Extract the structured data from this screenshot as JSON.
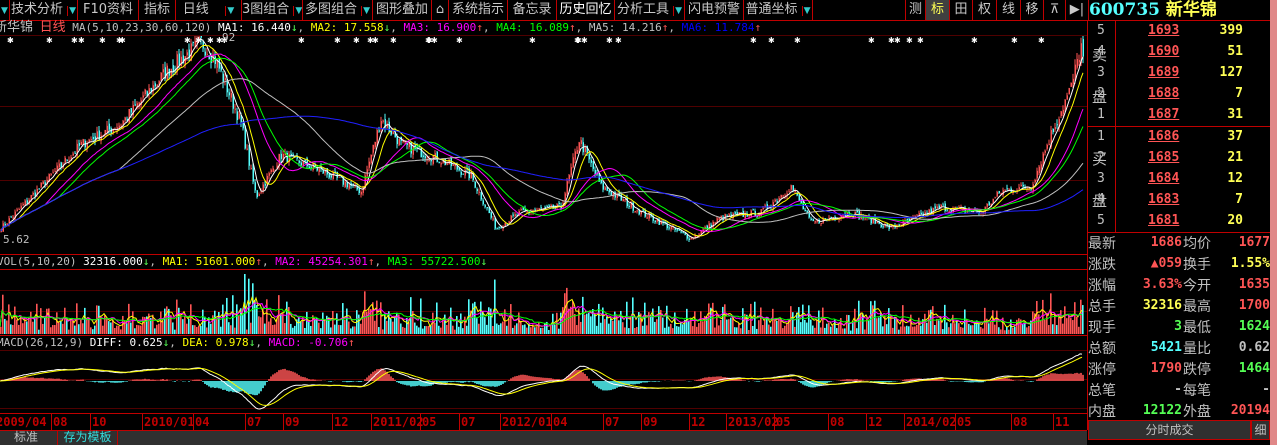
{
  "toolbar": {
    "items": [
      "技术分析",
      "F10资料",
      "指标",
      "日线",
      "3图组合",
      "多图组合",
      "图形叠加",
      "系统指示",
      "备忘录",
      "历史回忆",
      "分析工具",
      "闪电预警",
      "普通坐标"
    ],
    "right_buttons": [
      "测",
      "标",
      "田",
      "权",
      "线",
      "移"
    ],
    "icons": [
      "lock-icon",
      "dropdown-triangle-icon",
      "window-icon",
      "play-end-icon"
    ]
  },
  "stock": {
    "code": "600735",
    "name": "新华锦"
  },
  "main_header": {
    "name": "新华锦",
    "period": "日线",
    "ma_params": "MA(5,10,23,30,60,120)",
    "ma": [
      {
        "label": "MA1: 16.440",
        "arrow": "↓",
        "color": "#ffffff"
      },
      {
        "label": "MA2: 17.558",
        "arrow": "↓",
        "color": "#ffff00"
      },
      {
        "label": "MA3: 16.900",
        "arrow": "↑",
        "color": "#ff00ff"
      },
      {
        "label": "MA4: 16.089",
        "arrow": "↑",
        "color": "#00ff00"
      },
      {
        "label": "MA5: 14.216",
        "arrow": "↑",
        "color": "#c0c0c0"
      },
      {
        "label": "MA6: 11.784",
        "arrow": "↑",
        "color": "#0000ff"
      }
    ],
    "high_label": "92",
    "low_label": "5.62"
  },
  "vol_header": {
    "params": "VOL(5,10,20)",
    "value": "32316.000",
    "value_arrow": "↓",
    "ma1": "MA1: 51601.000",
    "ma1_arrow": "↑",
    "ma2": "MA2: 45254.301",
    "ma2_arrow": "↑",
    "ma3": "MA3: 55722.500",
    "ma3_arrow": "↓"
  },
  "macd_header": {
    "params": "MACD(26,12,9)",
    "diff": "DIFF: 0.625",
    "diff_arrow": "↓",
    "dea": "DEA: 0.978",
    "dea_arrow": "↓",
    "macd": "MACD: -0.706",
    "macd_arrow": "↑"
  },
  "date_axis": [
    "2009/04",
    "08",
    "10",
    "2010/01",
    "04",
    "07",
    "09",
    "12",
    "2011/02",
    "05",
    "07",
    "2012/01",
    "04",
    "07",
    "09",
    "12",
    "2013/02",
    "05",
    "08",
    "12",
    "2014/02",
    "05",
    "08",
    "11"
  ],
  "bottom_tabs": [
    "标准",
    "存为模板"
  ],
  "order_book": {
    "sell_label": [
      "卖",
      "盘"
    ],
    "buy_label": [
      "买",
      "盘"
    ],
    "sell": [
      {
        "level": "5",
        "price": "1693",
        "vol": "399"
      },
      {
        "level": "4",
        "price": "1690",
        "vol": "51"
      },
      {
        "level": "3",
        "price": "1689",
        "vol": "127"
      },
      {
        "level": "2",
        "price": "1688",
        "vol": "7"
      },
      {
        "level": "1",
        "price": "1687",
        "vol": "31"
      }
    ],
    "buy": [
      {
        "level": "1",
        "price": "1686",
        "vol": "37"
      },
      {
        "level": "2",
        "price": "1685",
        "vol": "21"
      },
      {
        "level": "3",
        "price": "1684",
        "vol": "12"
      },
      {
        "level": "4",
        "price": "1683",
        "vol": "7"
      },
      {
        "level": "5",
        "price": "1681",
        "vol": "20"
      }
    ]
  },
  "quote": [
    {
      "l1": "最新",
      "v1": "1686",
      "c1": "#ff5555",
      "l2": "均价",
      "v2": "1677",
      "c2": "#ff5555"
    },
    {
      "l1": "涨跌",
      "v1": "▲059",
      "c1": "#ff5555",
      "l2": "换手",
      "v2": "1.55%",
      "c2": "#ffff55"
    },
    {
      "l1": "涨幅",
      "v1": "3.63%",
      "c1": "#ff5555",
      "l2": "今开",
      "v2": "1635",
      "c2": "#ff5555"
    },
    {
      "l1": "总手",
      "v1": "32316",
      "c1": "#ffff55",
      "l2": "最高",
      "v2": "1700",
      "c2": "#ff5555"
    },
    {
      "l1": "现手",
      "v1": "3",
      "c1": "#55ff55",
      "l2": "最低",
      "v2": "1624",
      "c2": "#55ff55"
    },
    {
      "l1": "总额",
      "v1": "5421",
      "c1": "#55ffff",
      "l2": "量比",
      "v2": "0.62",
      "c2": "#c0c0c0"
    },
    {
      "l1": "涨停",
      "v1": "1790",
      "c1": "#ff5555",
      "l2": "跌停",
      "v2": "1464",
      "c2": "#55ff55"
    },
    {
      "l1": "总笔",
      "v1": "-",
      "c1": "#c0c0c0",
      "l2": "每笔",
      "v2": "-",
      "c2": "#c0c0c0"
    },
    {
      "l1": "内盘",
      "v1": "12122",
      "c1": "#55ff55",
      "l2": "外盘",
      "v2": "20194",
      "c2": "#ff5555"
    }
  ],
  "tick_button": "分时成交",
  "detail_button": "细",
  "colors": {
    "up": "#ff5555",
    "down": "#55ffff",
    "border": "#c00000",
    "ma_long": "#0000ff"
  },
  "chart_data": {
    "type": "line",
    "title": "600735 新华锦 日线 (approximate price path)",
    "ylim": [
      5.62,
      19.92
    ],
    "x": [
      0,
      40,
      80,
      120,
      165,
      200,
      215,
      240,
      255,
      280,
      320,
      360,
      380,
      400,
      440,
      470,
      495,
      520,
      560,
      578,
      600,
      640,
      690,
      720,
      760,
      790,
      810,
      850,
      890,
      940,
      980,
      1000,
      1030,
      1050,
      1070,
      1080,
      1085
    ],
    "price": [
      6.98,
      9.82,
      12.67,
      14.09,
      17.64,
      19.64,
      18.36,
      14.09,
      9.11,
      11.95,
      10.89,
      9.47,
      14.44,
      12.67,
      11.6,
      10.53,
      6.98,
      8.05,
      8.4,
      13.02,
      9.82,
      8.05,
      6.27,
      7.69,
      8.05,
      9.82,
      7.33,
      8.05,
      6.98,
      8.4,
      8.05,
      9.47,
      9.82,
      13.38,
      16.58,
      19.42,
      16.86
    ]
  }
}
